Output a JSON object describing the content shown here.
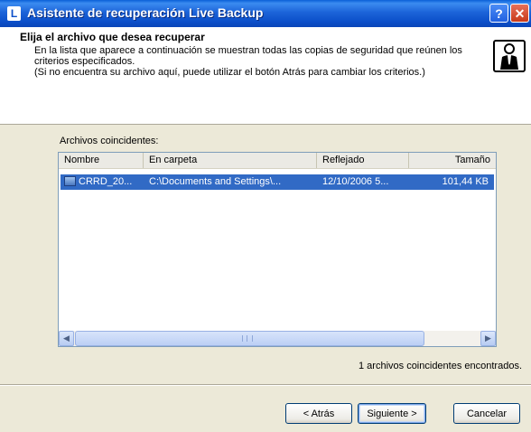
{
  "window": {
    "title": "Asistente de recuperación Live Backup",
    "icon_letter": "L",
    "help_label": "?",
    "close_label": "✕"
  },
  "header": {
    "title": "Elija el archivo que desea recuperar",
    "desc_line1": "En la lista que aparece a continuación se muestran todas las copias de seguridad que reúnen los criterios especificados.",
    "desc_line2": "(Si no encuentra su archivo aquí, puede utilizar el botón Atrás para cambiar los criterios.)"
  },
  "list": {
    "label": "Archivos coincidentes:",
    "columns": [
      "Nombre",
      "En carpeta",
      "Reflejado",
      "Tamaño"
    ],
    "rows": [
      {
        "name": "CRRD_20...",
        "folder": "C:\\Documents and Settings\\...",
        "reflected": "12/10/2006 5...",
        "size": "101,44 KB",
        "selected": true
      }
    ],
    "scroll_left": "◀",
    "scroll_right": "▶"
  },
  "status": "1  archivos coincidentes encontrados.",
  "buttons": {
    "back": "< Atrás",
    "next": "Siguiente >",
    "cancel": "Cancelar"
  },
  "colors": {
    "title_bar": "#0B4FC9",
    "selection": "#316AC5",
    "dialog_bg": "#ECE9D8"
  }
}
